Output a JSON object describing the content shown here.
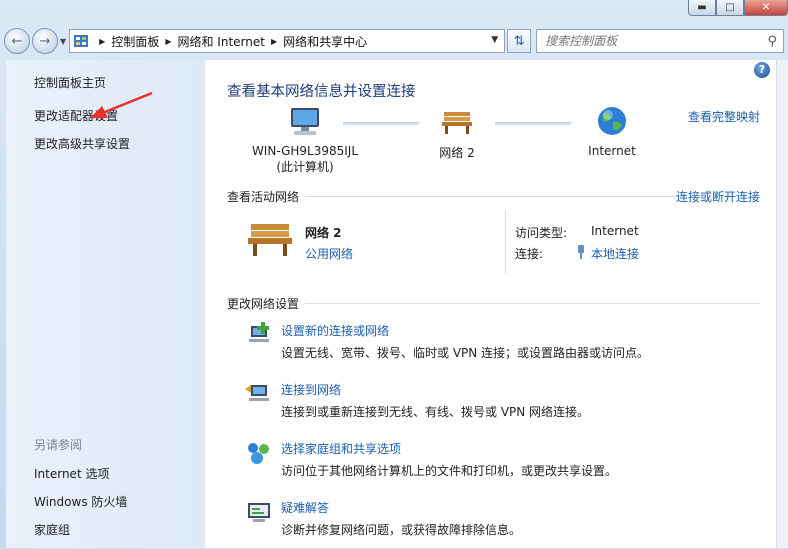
{
  "window": {
    "min_icon": "minimize-icon",
    "max_icon": "maximize-icon",
    "close_icon": "close-icon"
  },
  "address_bar": {
    "breadcrumbs": [
      "控制面板",
      "网络和 Internet",
      "网络和共享中心"
    ]
  },
  "search": {
    "placeholder": "搜索控制面板"
  },
  "sidebar": {
    "home": "控制面板主页",
    "items": [
      "更改适配器设置",
      "更改高级共享设置"
    ],
    "see_also_title": "另请参阅",
    "see_also": [
      "Internet 选项",
      "Windows 防火墙",
      "家庭组"
    ]
  },
  "main": {
    "title": "查看基本网络信息并设置连接",
    "full_map_link": "查看完整映射",
    "map": {
      "computer_name": "WIN-GH9L3985IJL",
      "computer_sub": "(此计算机)",
      "network": "网络  2",
      "internet": "Internet"
    },
    "active_networks": {
      "header": "查看活动网络",
      "connect_link": "连接或断开连接",
      "network_name": "网络  2",
      "network_type": "公用网络",
      "access_type_label": "访问类型:",
      "access_type_value": "Internet",
      "connection_label": "连接:",
      "connection_value": "本地连接"
    },
    "change_settings": {
      "header": "更改网络设置",
      "tasks": [
        {
          "title": "设置新的连接或网络",
          "desc": "设置无线、宽带、拨号、临时或 VPN 连接；或设置路由器或访问点。"
        },
        {
          "title": "连接到网络",
          "desc": "连接到或重新连接到无线、有线、拨号或 VPN 网络连接。"
        },
        {
          "title": "选择家庭组和共享选项",
          "desc": "访问位于其他网络计算机上的文件和打印机，或更改共享设置。"
        },
        {
          "title": "疑难解答",
          "desc": "诊断并修复网络问题，或获得故障排除信息。"
        }
      ]
    }
  },
  "colors": {
    "link": "#1c5fb0",
    "title": "#1e3d7a",
    "arrow": "#e8322c"
  }
}
